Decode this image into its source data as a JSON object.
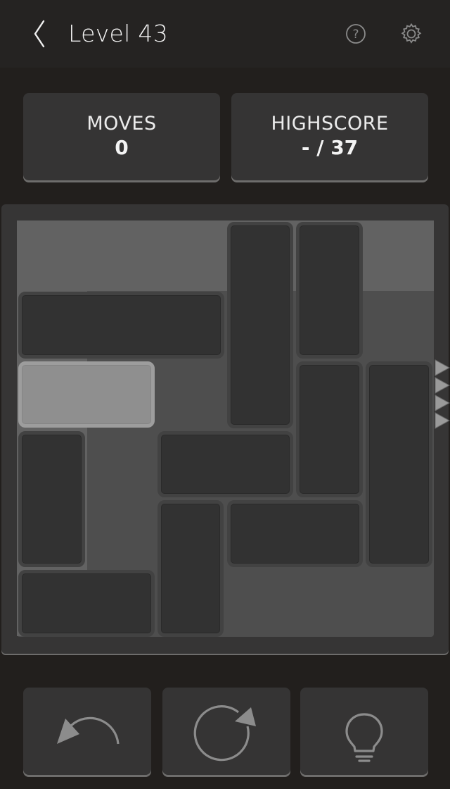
{
  "header": {
    "title": "Level 43",
    "back_icon": "chevron-left-icon",
    "help_icon": "question-circle-icon",
    "settings_icon": "gear-icon"
  },
  "stats": {
    "moves_label": "MOVES",
    "moves_value": "0",
    "highscore_label": "HIGHSCORE",
    "highscore_value": "- / 37"
  },
  "board": {
    "grid_columns": 6,
    "grid_rows": 6,
    "player_block": "target-block",
    "exit_side": "right",
    "exit_row": 3,
    "blocks": [
      {
        "id": "h1",
        "col": 0,
        "row": 1,
        "w": 3,
        "h": 1
      },
      {
        "id": "v1",
        "col": 3,
        "row": 0,
        "w": 1,
        "h": 3
      },
      {
        "id": "v2",
        "col": 4,
        "row": 0,
        "w": 1,
        "h": 2
      },
      {
        "id": "player",
        "col": 0,
        "row": 2,
        "w": 2,
        "h": 1,
        "player": true
      },
      {
        "id": "v3",
        "col": 4,
        "row": 2,
        "w": 1,
        "h": 2
      },
      {
        "id": "v4",
        "col": 5,
        "row": 2,
        "w": 1,
        "h": 3
      },
      {
        "id": "v5",
        "col": 0,
        "row": 3,
        "w": 1,
        "h": 2
      },
      {
        "id": "h2",
        "col": 2,
        "row": 3,
        "w": 2,
        "h": 1
      },
      {
        "id": "v6",
        "col": 2,
        "row": 4,
        "w": 1,
        "h": 2
      },
      {
        "id": "h3",
        "col": 3,
        "row": 4,
        "w": 2,
        "h": 1
      },
      {
        "id": "h4",
        "col": 0,
        "row": 5,
        "w": 2,
        "h": 1
      }
    ]
  },
  "controls": {
    "undo_icon": "undo-arrow-icon",
    "restart_icon": "restart-circular-arrow-icon",
    "hint_icon": "lightbulb-icon"
  },
  "colors": {
    "background": "#221f1d",
    "board": "#4e4e4e",
    "block": "#323232",
    "player_block": "#8f8f8f",
    "card": "#353434"
  }
}
